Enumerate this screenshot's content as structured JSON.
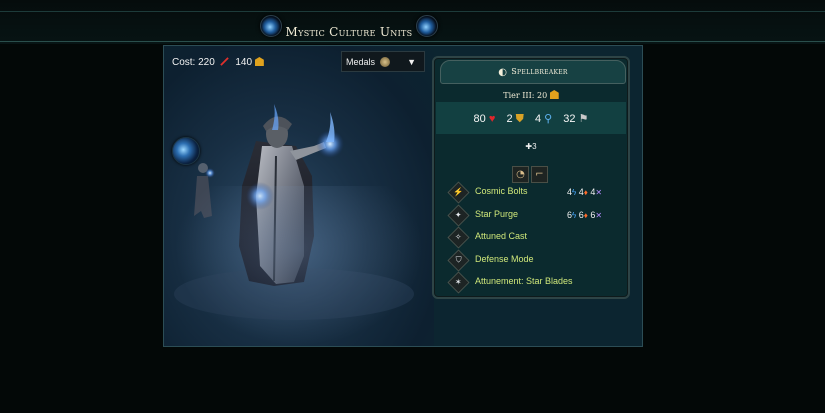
{
  "header": {
    "title": "Mystic Culture Units"
  },
  "colors": {
    "accent": "#2c4d55",
    "card_bg": "#0b2a2e",
    "ability_text": "#d0e87a",
    "health": "#e0262c",
    "gold": "#e0a21d"
  },
  "unit": {
    "cost_label": "Cost:",
    "cost_production": "220",
    "cost_gold": "140",
    "medals_label": "Medals",
    "name": "Spellbreaker",
    "tier": "Tier III: 20",
    "stats": {
      "health": "80",
      "defense": "2",
      "movement": "4",
      "speed": "32"
    },
    "extra_stat": "3",
    "abilities": [
      {
        "name": "Cosmic Bolts",
        "icon": "bolts-icon",
        "damage": [
          "4",
          "4",
          "4"
        ]
      },
      {
        "name": "Star Purge",
        "icon": "purge-icon",
        "damage": [
          "6",
          "6",
          "6"
        ]
      },
      {
        "name": "Attuned Cast",
        "icon": "cast-icon",
        "damage": []
      },
      {
        "name": "Defense Mode",
        "icon": "shield-icon",
        "damage": []
      },
      {
        "name": "Attunement: Star Blades",
        "icon": "blades-icon",
        "damage": []
      }
    ]
  }
}
